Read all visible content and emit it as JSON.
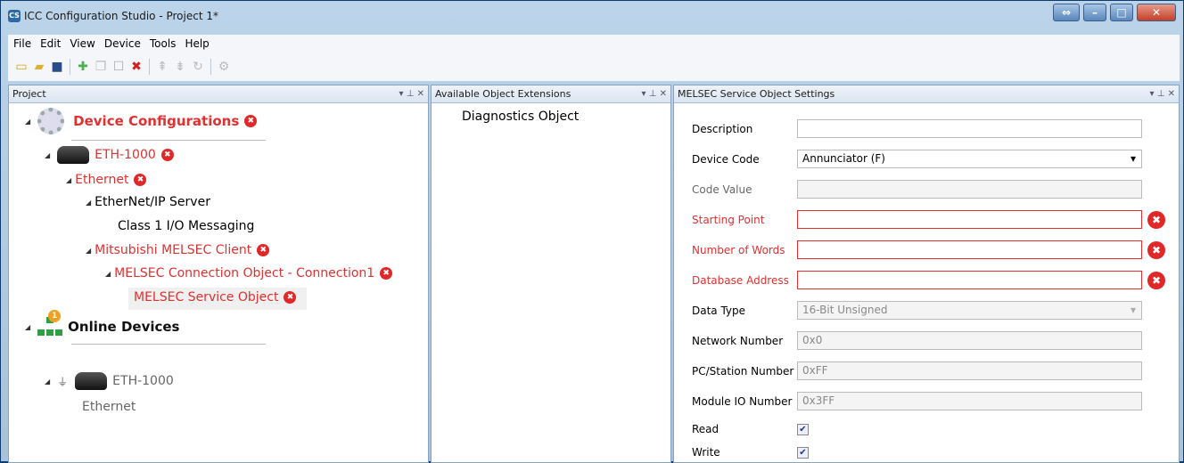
{
  "window": {
    "title": "ICC Configuration Studio - Project 1*",
    "app_icon": "CS"
  },
  "menu": [
    "File",
    "Edit",
    "View",
    "Device",
    "Tools",
    "Help"
  ],
  "toolbar_icons": [
    "new-icon",
    "open-icon",
    "save-icon",
    "add-icon",
    "copy-icon",
    "stop-icon",
    "delete-icon",
    "move-up-icon",
    "move-down-icon",
    "refresh-icon",
    "settings-icon"
  ],
  "panels": {
    "project": {
      "title": "Project"
    },
    "extensions": {
      "title": "Available Object Extensions",
      "items": [
        "Diagnostics Object"
      ]
    },
    "settings": {
      "title": "MELSEC Service Object Settings"
    }
  },
  "tree": {
    "device_configurations": "Device Configurations",
    "eth1000": "ETH-1000",
    "ethernet": "Ethernet",
    "ethernetip_server": "EtherNet/IP Server",
    "class1": "Class 1 I/O Messaging",
    "melsec_client": "Mitsubishi MELSEC Client",
    "connection": "MELSEC Connection Object - Connection1",
    "service_object": "MELSEC Service Object",
    "online_devices": "Online Devices",
    "online_badge": "1",
    "online_eth1000": "ETH-1000",
    "online_ethernet": "Ethernet"
  },
  "settings": {
    "description": {
      "label": "Description",
      "value": ""
    },
    "device_code": {
      "label": "Device Code",
      "value": "Annunciator (F)"
    },
    "code_value": {
      "label": "Code Value",
      "value": ""
    },
    "starting_point": {
      "label": "Starting Point",
      "value": ""
    },
    "number_of_words": {
      "label": "Number of Words",
      "value": ""
    },
    "database_address": {
      "label": "Database Address",
      "value": ""
    },
    "data_type": {
      "label": "Data Type",
      "value": "16-Bit Unsigned"
    },
    "network_number": {
      "label": "Network Number",
      "value": "0x0"
    },
    "pc_station_number": {
      "label": "PC/Station Number",
      "value": "0xFF"
    },
    "module_io_number": {
      "label": "Module IO Number",
      "value": "0x3FF"
    },
    "read": {
      "label": "Read",
      "checked": true
    },
    "write": {
      "label": "Write",
      "checked": true
    }
  },
  "colors": {
    "error": "#e03030",
    "accent": "#2f6aa8"
  }
}
